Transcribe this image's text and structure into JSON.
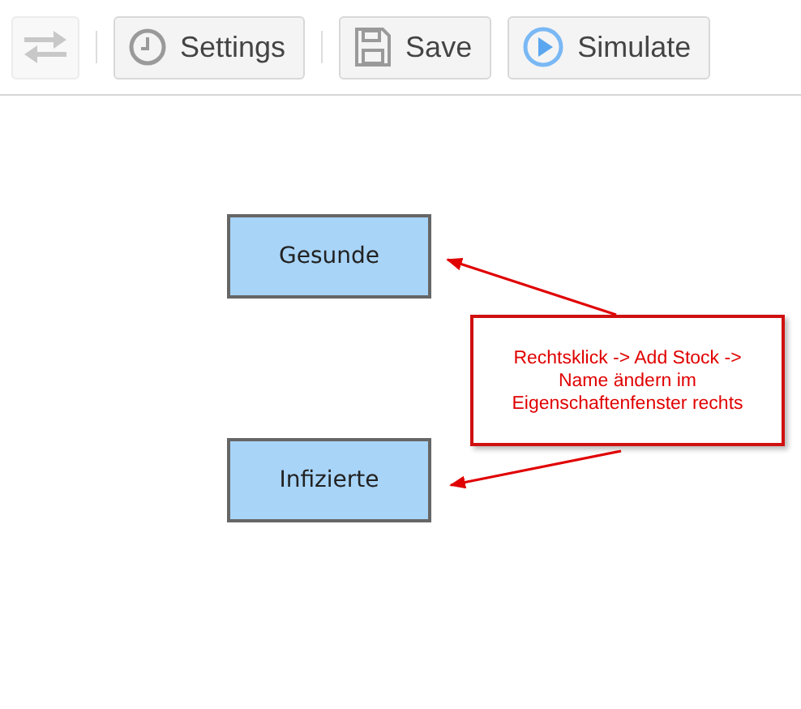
{
  "toolbar": {
    "buttons": [
      {
        "kind": "swap",
        "disabled": true
      },
      {
        "kind": "separator"
      },
      {
        "kind": "clock",
        "label": "Settings",
        "disabled": false
      },
      {
        "kind": "separator"
      },
      {
        "kind": "save",
        "label": "Save",
        "disabled": false
      },
      {
        "kind": "play",
        "label": "Simulate",
        "disabled": false
      }
    ]
  },
  "canvas": {
    "stocks": [
      {
        "name": "Gesunde"
      },
      {
        "name": "Infizierte"
      }
    ],
    "callout": {
      "text": "Rechtsklick -> Add Stock -> Name ändern im Eigenschaftenfenster rechts"
    }
  }
}
